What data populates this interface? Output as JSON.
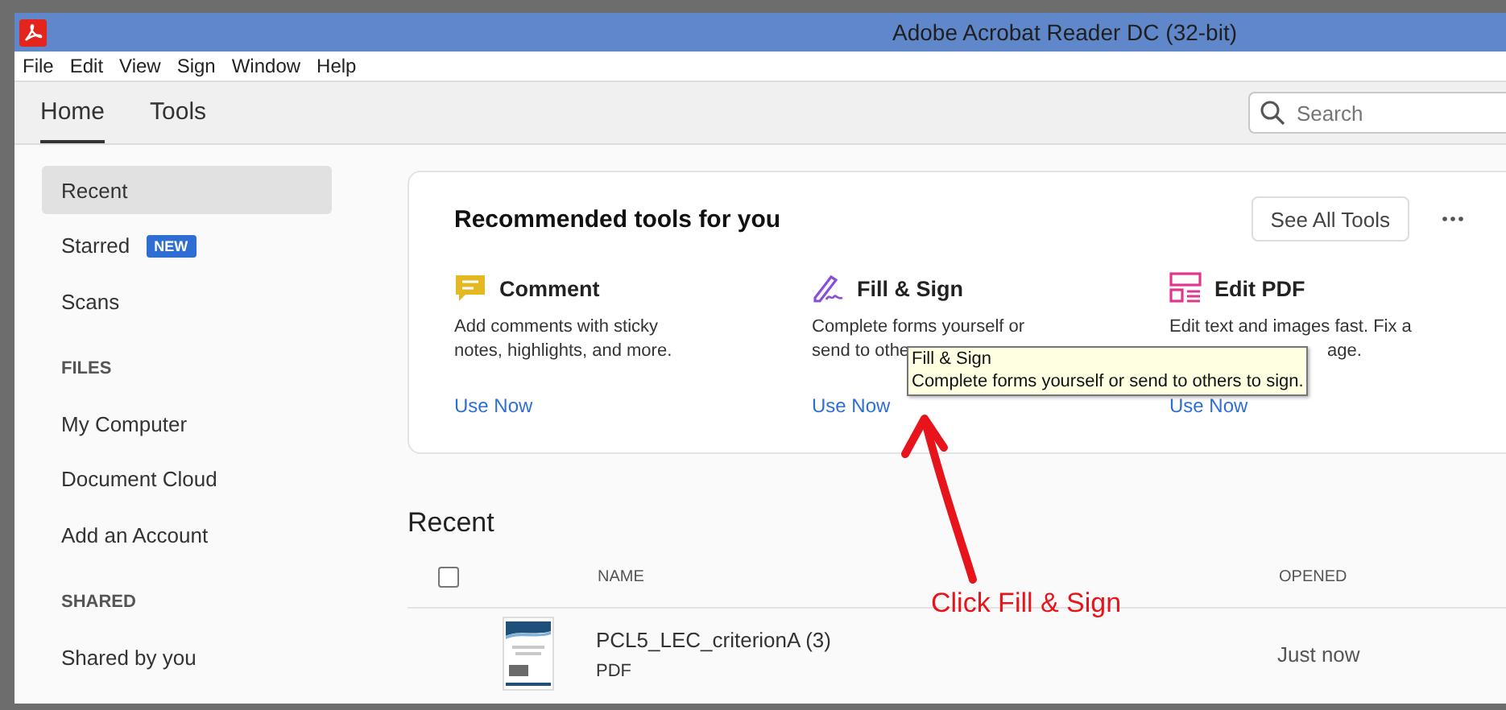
{
  "window": {
    "title": "Adobe Acrobat Reader DC (32-bit)"
  },
  "menu": [
    "File",
    "Edit",
    "View",
    "Sign",
    "Window",
    "Help"
  ],
  "tabs": [
    {
      "label": "Home",
      "selected": true
    },
    {
      "label": "Tools",
      "selected": false
    }
  ],
  "search": {
    "placeholder": "Search"
  },
  "sidebar": {
    "items": [
      {
        "kind": "item",
        "label": "Recent",
        "selected": true
      },
      {
        "kind": "item",
        "label": "Starred",
        "badge": "NEW",
        "selected": false
      },
      {
        "kind": "item",
        "label": "Scans",
        "selected": false
      },
      {
        "kind": "heading",
        "label": "FILES"
      },
      {
        "kind": "item",
        "label": "My Computer",
        "selected": false
      },
      {
        "kind": "item",
        "label": "Document Cloud",
        "selected": false
      },
      {
        "kind": "item",
        "label": "Add an Account",
        "selected": false
      },
      {
        "kind": "heading",
        "label": "SHARED"
      },
      {
        "kind": "item",
        "label": "Shared by you",
        "selected": false
      }
    ]
  },
  "recommended": {
    "title": "Recommended tools for you",
    "see_all": "See All Tools",
    "tools": [
      {
        "kind": "comment",
        "name": "Comment",
        "description": [
          {
            "text": "Add comments with sticky",
            "covered": false
          },
          {
            "text": "notes, highlights, and more.",
            "covered": false
          }
        ],
        "action": "Use Now"
      },
      {
        "kind": "fill-sign",
        "name": "Fill & Sign",
        "description": [
          {
            "text": "Complete forms yourself or",
            "covered": false
          },
          {
            "text": "send to othe",
            "covered": false
          }
        ],
        "action": "Use Now"
      },
      {
        "kind": "edit-pdf",
        "name": "Edit PDF",
        "description": [
          {
            "text": "Edit text and images fast. Fix a",
            "covered": false
          },
          {
            "text": "age.",
            "covered": true
          }
        ],
        "action": "Use Now"
      }
    ]
  },
  "tooltip": {
    "title": "Fill & Sign",
    "text": "Complete forms yourself or send to others to sign."
  },
  "recent": {
    "title": "Recent",
    "select_all": {
      "checked": false
    },
    "columns": [
      "NAME",
      "OPENED"
    ],
    "rows": [
      {
        "name": "PCL5_LEC_criterionA (3)",
        "type": "PDF",
        "opened": "Just now"
      }
    ]
  },
  "annotation": {
    "text": "Click Fill & Sign"
  }
}
